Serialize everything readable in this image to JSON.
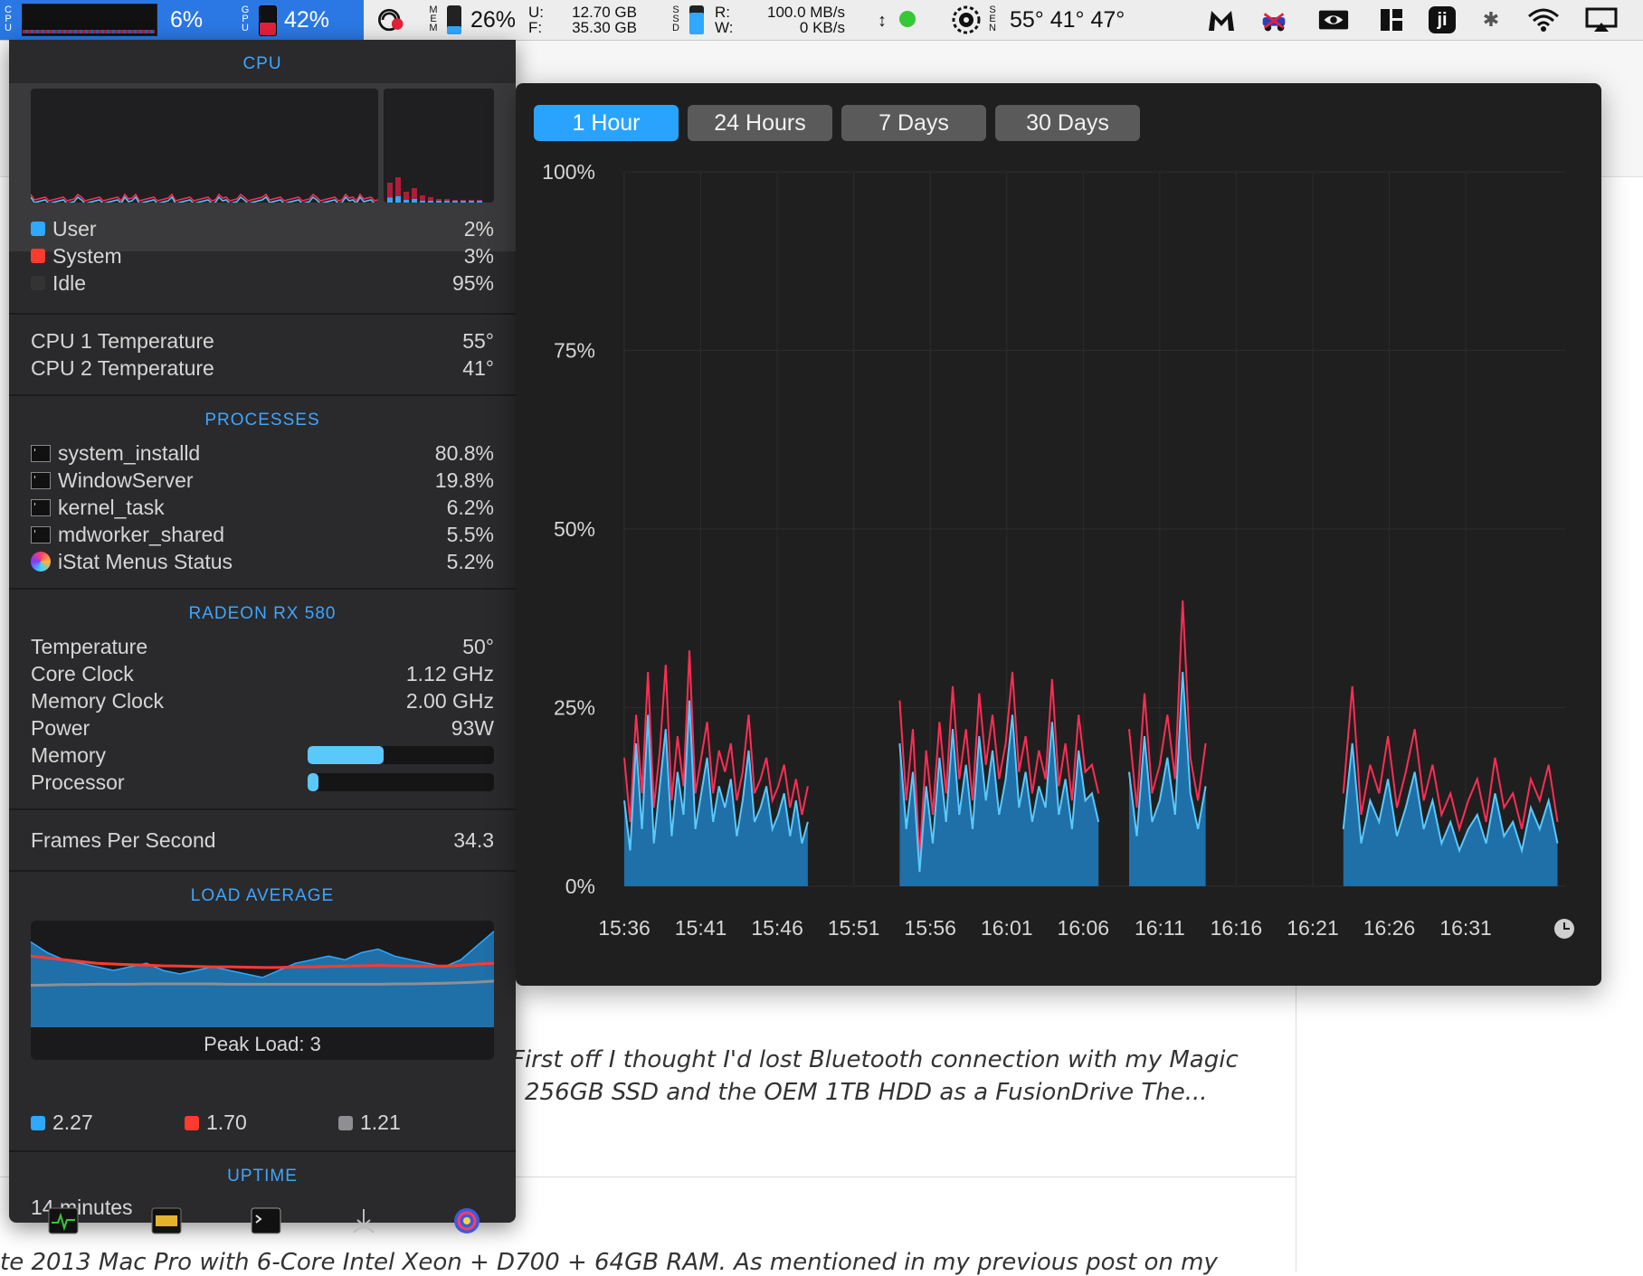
{
  "menubar": {
    "cpu": {
      "label": "CPU",
      "pct": "6%"
    },
    "gpu": {
      "label": "GPU",
      "pct": "42%"
    },
    "mem": {
      "label": "MEM",
      "pct": "26%",
      "used_label": "U:",
      "used": "12.70 GB",
      "free_label": "F:",
      "free": "35.30 GB"
    },
    "ssd": {
      "label": "SSD",
      "read_label": "R:",
      "read": "100.0 MB/s",
      "write_label": "W:",
      "write": "0 KB/s"
    },
    "sensors": {
      "label": "SEN",
      "temps": "55° 41° 47°"
    },
    "icons": [
      "istat-icon",
      "fan-icon",
      "malwarebytes-icon",
      "car-icon",
      "nvidia-icon",
      "grid-icon",
      "ji-icon",
      "bluetooth-icon",
      "wifi-icon",
      "airplay-icon"
    ]
  },
  "background_page": {
    "snippet_line1": "First off I thought I'd lost Bluetooth connection with my Magic",
    "snippet_line2": "256GB SSD and the OEM 1TB HDD as a FusionDrive The...",
    "snippet_line3": "te 2013 Mac Pro with 6-Core Intel Xeon + D700 + 64GB RAM. As mentioned in my previous post on my"
  },
  "dropdown": {
    "cpu_title": "CPU",
    "cpu_usage": [
      {
        "label": "User",
        "value": "2%",
        "color": "#2fa8ff"
      },
      {
        "label": "System",
        "value": "3%",
        "color": "#ff3b30"
      },
      {
        "label": "Idle",
        "value": "95%",
        "color": "#333333"
      }
    ],
    "cpu_temps": [
      {
        "label": "CPU 1 Temperature",
        "value": "55°"
      },
      {
        "label": "CPU 2 Temperature",
        "value": "41°"
      }
    ],
    "processes_title": "PROCESSES",
    "processes": [
      {
        "name": "system_installd",
        "value": "80.8%"
      },
      {
        "name": "WindowServer",
        "value": "19.8%"
      },
      {
        "name": "kernel_task",
        "value": "6.2%"
      },
      {
        "name": "mdworker_shared",
        "value": "5.5%"
      },
      {
        "name": "iStat Menus Status",
        "value": "5.2%"
      }
    ],
    "gpu_title": "RADEON RX 580",
    "gpu": [
      {
        "label": "Temperature",
        "value": "50°"
      },
      {
        "label": "Core Clock",
        "value": "1.12 GHz"
      },
      {
        "label": "Memory Clock",
        "value": "2.00 GHz"
      },
      {
        "label": "Power",
        "value": "93W"
      }
    ],
    "gpu_bars": [
      {
        "label": "Memory",
        "fraction": 0.41
      },
      {
        "label": "Processor",
        "fraction": 0.06
      }
    ],
    "fps_label": "Frames Per Second",
    "fps_value": "34.3",
    "load_title": "LOAD AVERAGE",
    "peak_load": "Peak Load: 3",
    "load_values": [
      {
        "value": "2.27",
        "color": "#2fa8ff"
      },
      {
        "value": "1.70",
        "color": "#ff3b30"
      },
      {
        "value": "1.21",
        "color": "#8e8e93"
      }
    ],
    "uptime_title": "UPTIME",
    "uptime_value": "14 minutes",
    "footer_icons": [
      "activity-monitor-icon",
      "console-icon",
      "terminal-icon",
      "usb-icon",
      "istat-icon"
    ]
  },
  "graph": {
    "tabs": [
      "1 Hour",
      "24 Hours",
      "7 Days",
      "30 Days"
    ],
    "active_tab": 0
  },
  "chart_data": {
    "type": "area",
    "y_tick_labels": [
      "100%",
      "75%",
      "50%",
      "25%",
      "0%"
    ],
    "ylim": [
      0,
      100
    ],
    "x_tick_labels": [
      "15:36",
      "15:41",
      "15:46",
      "15:51",
      "15:56",
      "16:01",
      "16:06",
      "16:11",
      "16:16",
      "16:21",
      "16:26",
      "16:31"
    ],
    "colors": {
      "user": "#1f6fa8",
      "user_line": "#5ac8fa",
      "system": "#ff2d55"
    },
    "segments": [
      {
        "start": "15:36",
        "end": "15:48",
        "user": [
          12,
          5,
          20,
          8,
          24,
          6,
          14,
          22,
          7,
          16,
          10,
          26,
          8,
          13,
          18,
          9,
          14,
          11,
          15,
          7,
          12,
          19,
          9,
          11,
          14,
          8,
          10,
          13,
          7,
          12,
          6,
          9
        ],
        "total": [
          18,
          9,
          24,
          13,
          30,
          11,
          19,
          31,
          12,
          21,
          14,
          33,
          13,
          18,
          23,
          13,
          19,
          16,
          20,
          12,
          16,
          24,
          13,
          15,
          18,
          12,
          14,
          17,
          11,
          15,
          10,
          14
        ]
      },
      {
        "start": "15:54",
        "end": "16:07",
        "user": [
          20,
          8,
          16,
          2,
          14,
          6,
          18,
          9,
          22,
          10,
          17,
          8,
          21,
          12,
          19,
          10,
          15,
          24,
          11,
          16,
          9,
          14,
          11,
          23,
          10,
          15,
          8,
          19,
          12,
          13,
          9
        ],
        "total": [
          26,
          12,
          22,
          4,
          19,
          10,
          23,
          13,
          28,
          15,
          22,
          12,
          27,
          17,
          24,
          15,
          20,
          30,
          16,
          21,
          13,
          19,
          15,
          29,
          14,
          20,
          12,
          24,
          16,
          17,
          13
        ]
      },
      {
        "start": "16:09",
        "end": "16:14",
        "user": [
          16,
          7,
          21,
          9,
          12,
          18,
          10,
          30,
          13,
          8,
          14
        ],
        "total": [
          22,
          11,
          27,
          13,
          17,
          24,
          15,
          40,
          18,
          12,
          20
        ]
      },
      {
        "start": "16:23",
        "end": "16:37",
        "user": [
          8,
          20,
          6,
          12,
          9,
          15,
          7,
          11,
          16,
          8,
          12,
          6,
          9,
          5,
          8,
          10,
          6,
          13,
          7,
          9,
          5,
          11,
          8,
          12,
          6
        ],
        "total": [
          13,
          28,
          10,
          17,
          13,
          21,
          11,
          16,
          22,
          12,
          17,
          10,
          13,
          8,
          12,
          15,
          9,
          18,
          11,
          13,
          8,
          15,
          12,
          17,
          9
        ]
      }
    ],
    "load_average_chart": {
      "type": "area",
      "ylim": [
        0,
        3
      ],
      "series": [
        {
          "values": [
            2.4,
            2.1,
            1.9,
            1.8,
            1.7,
            1.6,
            1.7,
            1.8,
            1.6,
            1.5,
            1.6,
            1.7,
            1.6,
            1.5,
            1.4,
            1.6,
            1.8,
            1.9,
            2.0,
            1.9,
            2.1,
            2.2,
            2.0,
            1.9,
            1.8,
            1.7,
            1.9,
            2.3,
            2.7
          ],
          "color": "#2fa8ff"
        },
        {
          "values": [
            2.0,
            1.95,
            1.9,
            1.85,
            1.8,
            1.78,
            1.76,
            1.75,
            1.73,
            1.72,
            1.71,
            1.7,
            1.7,
            1.69,
            1.68,
            1.68,
            1.7,
            1.7,
            1.71,
            1.72,
            1.73,
            1.74,
            1.73,
            1.72,
            1.72,
            1.72,
            1.74,
            1.78,
            1.8
          ],
          "color": "#ff3b30"
        },
        {
          "values": [
            1.18,
            1.19,
            1.2,
            1.2,
            1.21,
            1.21,
            1.21,
            1.22,
            1.22,
            1.22,
            1.22,
            1.22,
            1.21,
            1.21,
            1.21,
            1.21,
            1.21,
            1.21,
            1.21,
            1.21,
            1.21,
            1.21,
            1.22,
            1.22,
            1.23,
            1.24,
            1.25,
            1.27,
            1.3
          ],
          "color": "#8e8e93"
        }
      ]
    }
  }
}
